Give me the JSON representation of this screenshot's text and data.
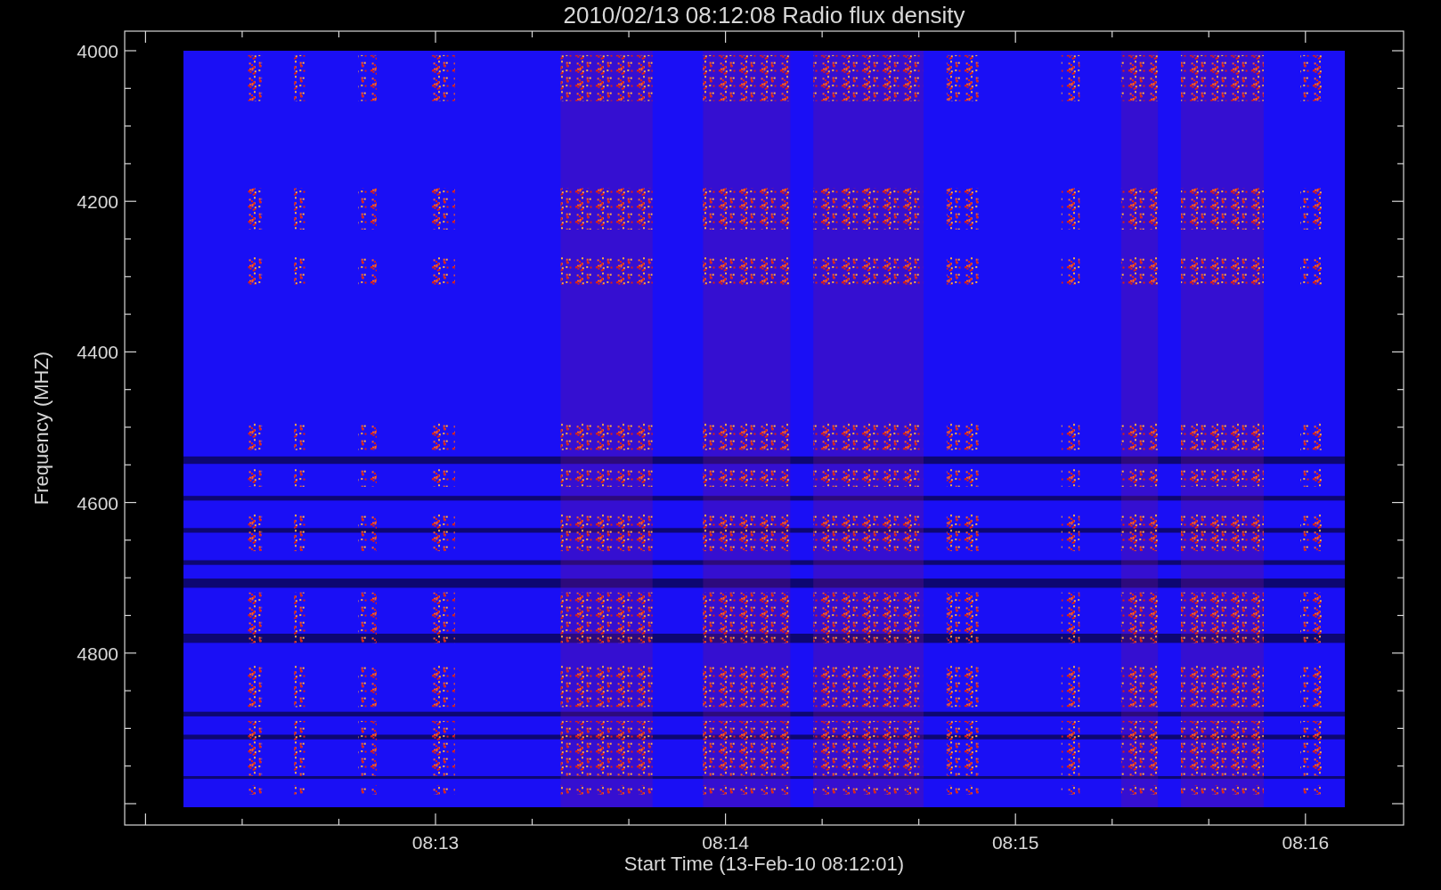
{
  "title": "2010/02/13 08:12:08 Radio flux density",
  "y_axis": {
    "label": "Frequency (MHZ)",
    "ticks": [
      "4000",
      "4200",
      "4400",
      "4600",
      "4800"
    ]
  },
  "x_axis": {
    "label": "Start Time (13-Feb-10 08:12:01)",
    "ticks": [
      "08:13",
      "08:14",
      "08:15",
      "08:16"
    ]
  }
}
